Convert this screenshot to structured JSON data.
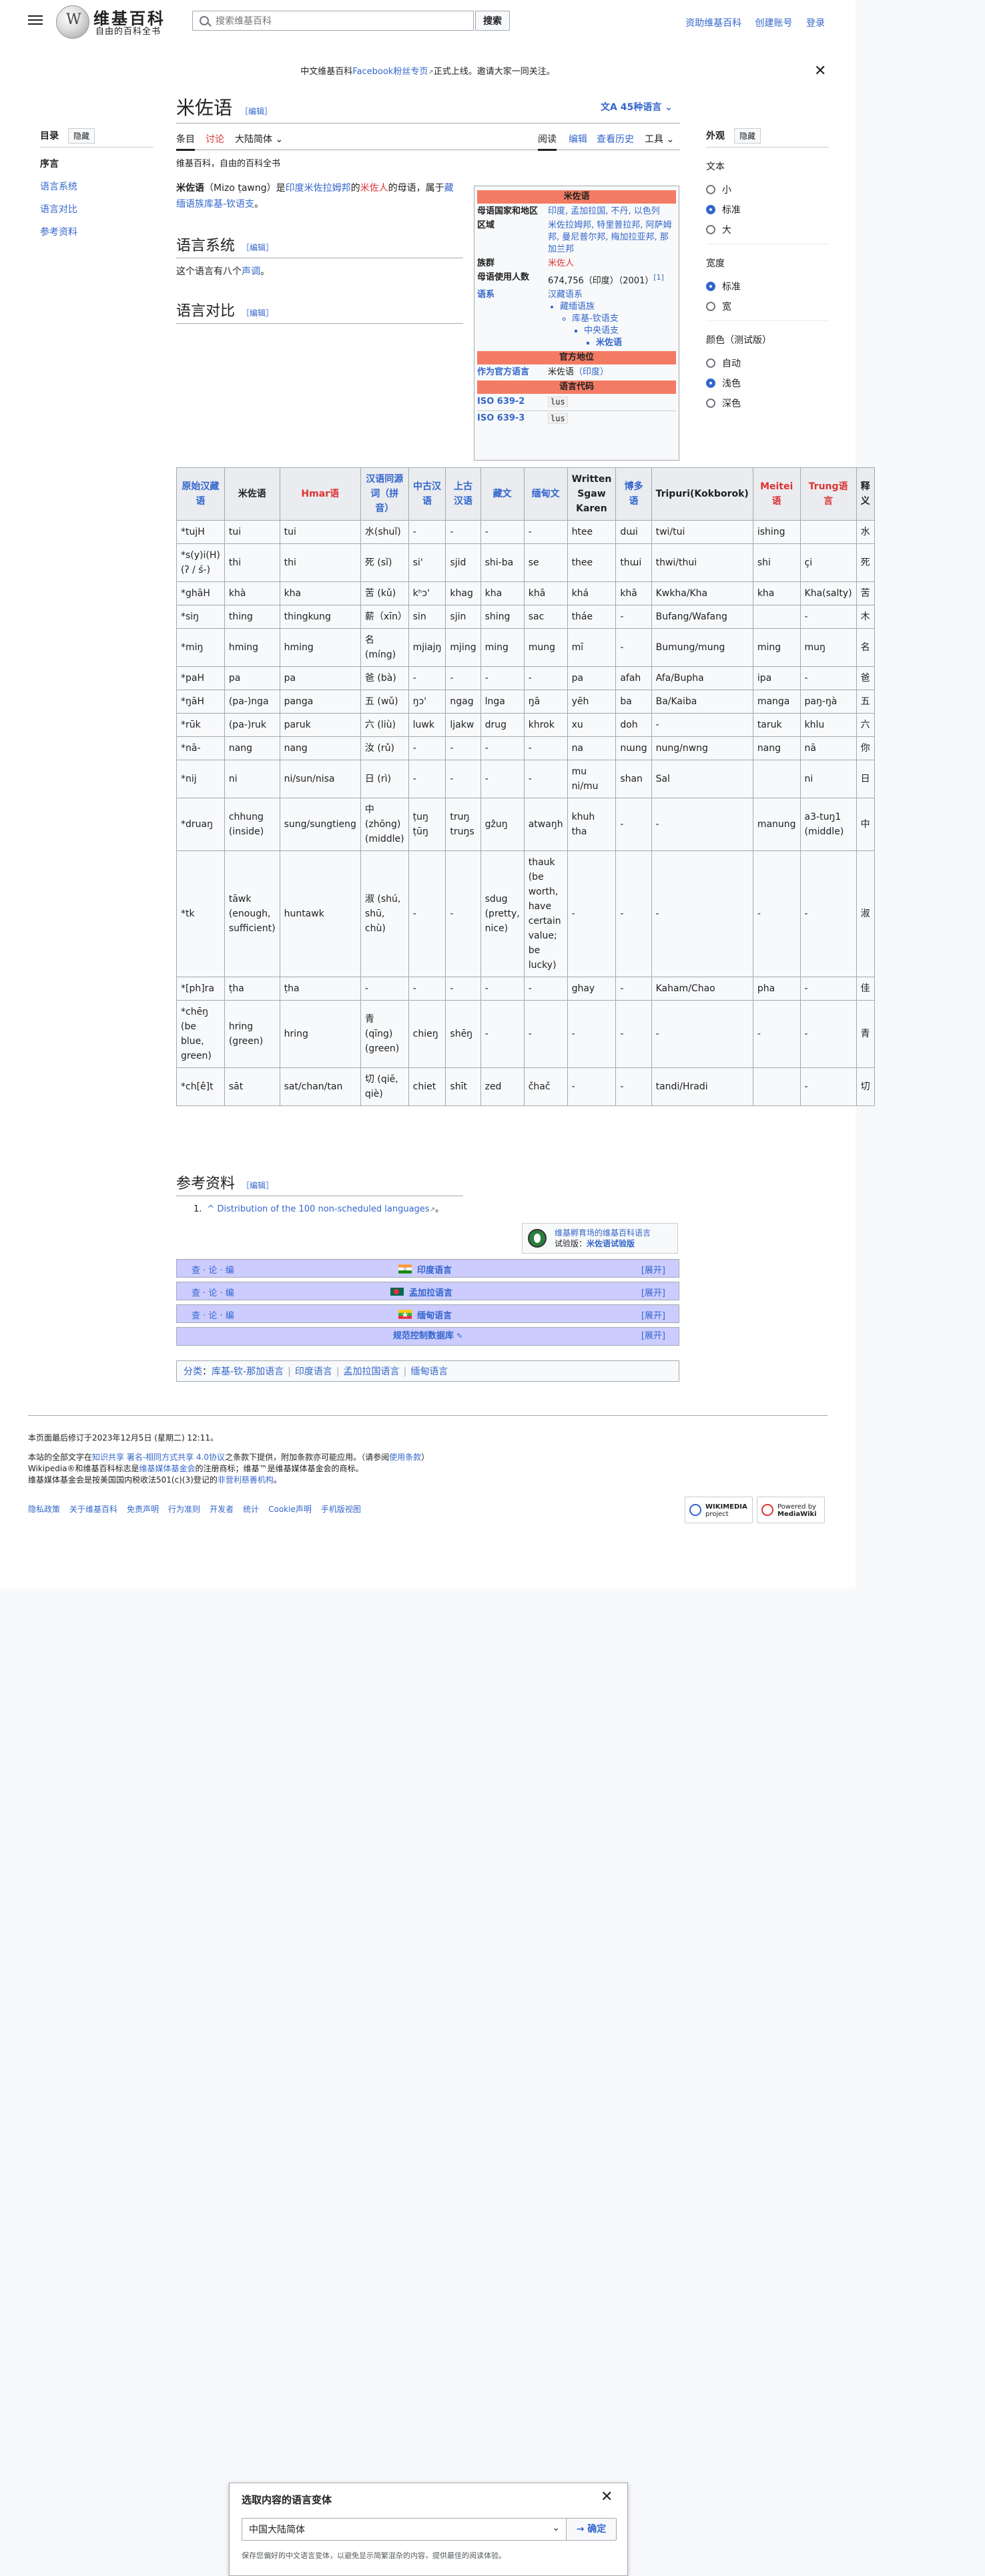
{
  "header": {
    "logo_title": "维基百科",
    "logo_subtitle": "自由的百科全书",
    "logo_glyph": "W",
    "search_placeholder": "搜索维基百科",
    "search_button": "搜索",
    "user_links": [
      "资助维基百科",
      "创建账号",
      "登录"
    ]
  },
  "sitenotice": {
    "pre": "中文维基百科",
    "link": "Facebook粉丝专页",
    "post": "正式上线。邀请大家一同关注。",
    "close": "✕"
  },
  "toc": {
    "title": "目录",
    "hide": "隐藏",
    "items": [
      "序言",
      "语言系统",
      "语言对比",
      "参考资料"
    ]
  },
  "appearance": {
    "title": "外观",
    "hide": "隐藏",
    "text_label": "文本",
    "text_options": [
      "小",
      "标准",
      "大"
    ],
    "width_label": "宽度",
    "width_options": [
      "标准",
      "宽"
    ],
    "color_label": "颜色（测试版）",
    "color_options": [
      "自动",
      "浅色",
      "深色"
    ]
  },
  "article": {
    "title": "米佐语",
    "edit": "［编辑］",
    "languages": "45种语言",
    "tabs": {
      "article": "条目",
      "talk": "讨论",
      "variant": "大陆简体",
      "read": "阅读",
      "edit": "编辑",
      "history": "查看历史",
      "tools": "工具"
    },
    "tagline": "维基百科，自由的百科全书",
    "lead": {
      "bold": "米佐语",
      "t1": "（Mizo ṭawng）是",
      "l1": "印度",
      "l2": "米佐拉姆邦",
      "t2": "的",
      "l3": "米佐人",
      "t3": "的母语，属于",
      "l4": "藏缅语族库基-钦语支",
      "t4": "。"
    },
    "section_system": "语言系统",
    "system_text_pre": "这个语言有八个",
    "system_text_link": "声调",
    "system_text_post": "。",
    "section_compare": "语言对比",
    "section_refs": "参考资料"
  },
  "infobox": {
    "title": "米佐语",
    "rows": [
      {
        "k": "母语国家和地区",
        "v": "印度, 孟加拉国, 不丹, 以色列"
      },
      {
        "k": "区域",
        "v": "米佐拉姆邦, 特里普拉邦, 阿萨姆邦, 曼尼普尔邦, 梅加拉亚邦, 那加兰邦"
      },
      {
        "k": "族群",
        "v": "米佐人"
      },
      {
        "k": "母语使用人数",
        "v": "674,756（印度）（2001）",
        "sup": "[1]"
      }
    ],
    "family_label": "语系",
    "family": [
      "汉藏语系",
      "藏缅语族",
      "库基-钦语支",
      "中央语支",
      "米佐语"
    ],
    "official_bar": "官方地位",
    "official_k": "作为官方语言",
    "official_v1": "米佐语",
    "official_v2": "（印度）",
    "codes_bar": "语言代码",
    "codes": [
      {
        "k": "ISO 639-2",
        "v": "lus"
      },
      {
        "k": "ISO 639-3",
        "v": "lus"
      }
    ]
  },
  "table": {
    "headers": [
      "原始汉藏语",
      "米佐语",
      "Hmar语",
      "汉语同源词（拼音）",
      "中古汉语",
      "上古汉语",
      "藏文",
      "缅甸文",
      "Written Sgaw Karen",
      "博多语",
      "Tripuri(Kokborok)",
      "Meitei语",
      "Trung语言",
      "释义"
    ],
    "rows": [
      [
        "*tujH",
        "tui",
        "tui",
        "水(shuǐ)",
        "-",
        "-",
        "-",
        "-",
        "htee",
        "dɯi",
        "twi/tui",
        "ishing",
        "",
        "水"
      ],
      [
        "*s(y)i(H)(ʔ / ś-)",
        "thi",
        "thi",
        "死 (sǐ)",
        "si'",
        "sjid",
        "shi-ba",
        "se",
        "thee",
        "thɯi",
        "thwi/thui",
        "shi",
        "çi",
        "死"
      ],
      [
        "*ghāH",
        "khà",
        "kha",
        "苦 (kǔ)",
        "kʰɔ'",
        "khag",
        "kha",
        "khā",
        "khá",
        "khā",
        "Kwkha/Kha",
        "kha",
        "Kha(salty)",
        "苦"
      ],
      [
        "*siŋ",
        "thing",
        "thingkung",
        "薪（xīn）",
        "sin",
        "sjin",
        "shing",
        "sac",
        "tháe",
        "-",
        "Bufang/Wafang",
        "",
        "-",
        "木"
      ],
      [
        "*miŋ",
        "hming",
        "hming",
        "名 (míng)",
        "mjiajŋ",
        "mjing",
        "ming",
        "mung",
        "mī",
        "-",
        "Bumung/mung",
        "ming",
        "muŋ",
        "名"
      ],
      [
        "*paH",
        "pa",
        "pa",
        "爸 (bà)",
        "-",
        "-",
        "-",
        "-",
        "pa",
        "afah",
        "Afa/Bupha",
        "ipa",
        "-",
        "爸"
      ],
      [
        "*ŋāH",
        "(pa-)nga",
        "panga",
        "五 (wǔ)",
        "ŋɔ'",
        "ngag",
        "lnga",
        "ŋā",
        "yēh",
        "ba",
        "Ba/Kaiba",
        "manga",
        "paŋ-ŋà",
        "五"
      ],
      [
        "*rūk",
        "(pa-)ruk",
        "paruk",
        "六 (liù)",
        "luwk",
        "ljakw",
        "drug",
        "khrok",
        "xu",
        "doh",
        "-",
        "taruk",
        "khlu",
        "六"
      ],
      [
        "*nā-",
        "nang",
        "nang",
        "汝 (rǔ)",
        "-",
        "-",
        "-",
        "-",
        "na",
        "nɯng",
        "nung/nwng",
        "nang",
        "nā",
        "你"
      ],
      [
        "*nij",
        "ni",
        "ni/sun/nisa",
        "日 (rì)",
        "-",
        "-",
        "-",
        "-",
        "mu ni/mu",
        "shan",
        "Sal",
        "",
        "ni",
        "日"
      ],
      [
        "*druaŋ",
        "chhung (inside)",
        "sung/sungtieng",
        "中 (zhōng) (middle)",
        "ṭuŋ ṭūŋ",
        "truŋ truŋs",
        "gẑuŋ",
        "atwaŋh",
        "khuh tha",
        "-",
        "-",
        "manung",
        "a3-tuŋ1 (middle)",
        "中"
      ],
      [
        "*tk",
        "tāwk (enough, sufficient)",
        "huntawk",
        "淑 (shú, shū, chù)",
        "-",
        "-",
        "sdug (pretty, nice)",
        "thauk (be worth, have certain value; be lucky)",
        "-",
        "-",
        "-",
        "-",
        "-",
        "淑"
      ],
      [
        "*[ph]ra",
        "ṭha",
        "ṭha",
        "-",
        "-",
        "-",
        "-",
        "-",
        "ghay",
        "-",
        "Kaham/Chao",
        "pha",
        "-",
        "佳"
      ],
      [
        "*chēŋ (be blue, green)",
        "hring (green)",
        "hring",
        "青 (qīng) (green)",
        "chieŋ",
        "shēŋ",
        "-",
        "-",
        "-",
        "-",
        "-",
        "-",
        "-",
        "青"
      ],
      [
        "*ch[ê]t",
        "sāt",
        "sat/chan/tan",
        "切 (qiē, qiè)",
        "chiet",
        "shīt",
        "zed",
        "čhač",
        "-",
        "-",
        "tandi/Hradi",
        "",
        "-",
        "切"
      ]
    ]
  },
  "refs": {
    "marker": "1.",
    "caret": "^",
    "text": "Distribution of the 100 non-scheduled languages",
    "end": "。"
  },
  "sister": {
    "line1": "维基孵育场的维基百科语言",
    "line2a": "试验版：",
    "line2b": "米佐语试验版"
  },
  "navboxes": [
    {
      "vde": "查 · 论 · 编",
      "title": "印度语言",
      "expand": "[展开]",
      "flag": "india"
    },
    {
      "vde": "查 · 论 · 编",
      "title": "孟加拉语言",
      "expand": "[展开]",
      "flag": "bangladesh"
    },
    {
      "vde": "查 · 论 · 编",
      "title": "缅甸语言",
      "expand": "[展开]",
      "flag": "myanmar"
    }
  ],
  "authority": {
    "title": "规范控制数据库",
    "expand": "[展开]"
  },
  "categories": {
    "label": "分类",
    "items": [
      "库基-钦-那加语言",
      "印度语言",
      "孟加拉国语言",
      "缅甸语言"
    ]
  },
  "footer": {
    "lastmod": "本页面最后修订于2023年12月5日 (星期二) 12:11。",
    "license1_a": "本站的全部文字在",
    "license1_link": "知识共享 署名-相同方式共享 4.0协议",
    "license1_b": "之条款下提供，附加条款亦可能应用。（请参阅",
    "license1_link2": "使用条款",
    "license1_c": "）",
    "license2_a": "Wikipedia®和维基百科标志是",
    "license2_link": "维基媒体基金会",
    "license2_b": "的注册商标；维基™是维基媒体基金会的商标。",
    "license3_a": "维基媒体基金会是按美国国内税收法501(c)(3)登记的",
    "license3_link": "非营利慈善机构",
    "license3_b": "。",
    "links": [
      "隐私政策",
      "关于维基百科",
      "免责声明",
      "行为准则",
      "开发者",
      "统计",
      "Cookie声明",
      "手机版视图"
    ],
    "badge1": [
      "WIKIMEDIA",
      "project"
    ],
    "badge2": [
      "Powered by",
      "MediaWiki"
    ]
  },
  "variant_dialog": {
    "title": "选取内容的语言变体",
    "close": "✕",
    "selected": "中国大陆简体",
    "ok": "确定",
    "note": "保存您偏好的中文语言变体，以避免显示简繁混杂的内容，提供最佳的阅读体验。"
  }
}
